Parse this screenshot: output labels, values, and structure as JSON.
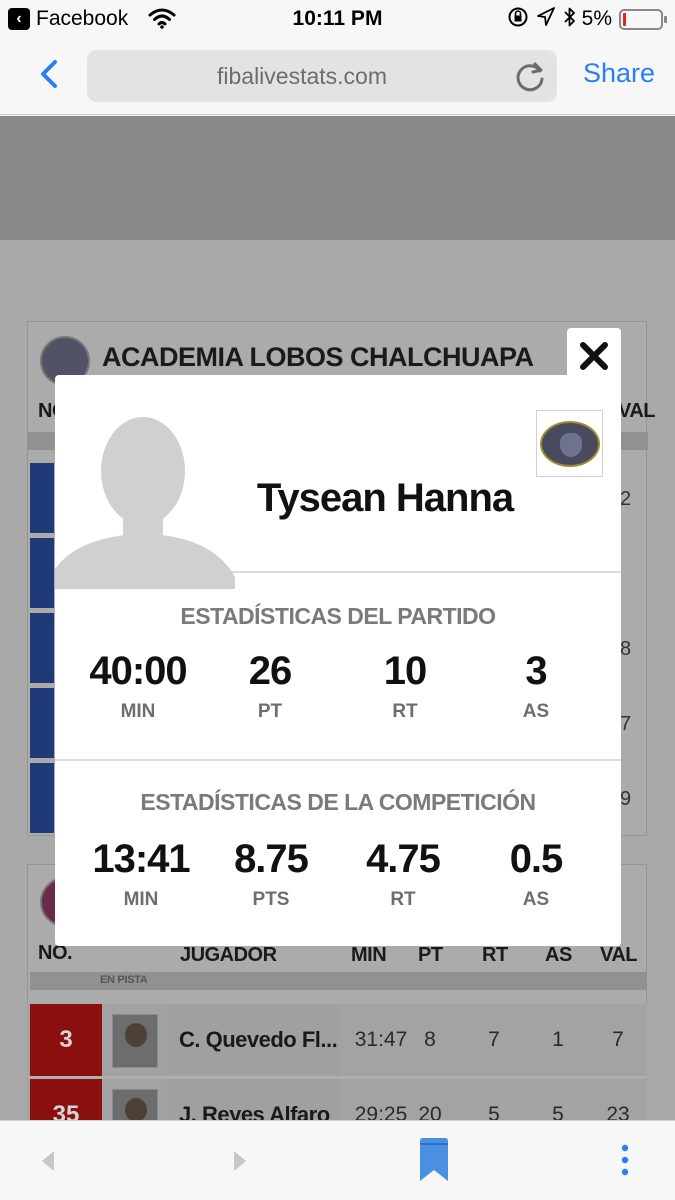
{
  "status_bar": {
    "app_name": "Facebook",
    "time": "10:11 PM",
    "battery_percent": "5%",
    "battery_level": 0.05
  },
  "browser": {
    "url": "fibalivestats.com",
    "share_label": "Share"
  },
  "background_page": {
    "team1": {
      "name": "ACADEMIA LOBOS CHALCHUAPA",
      "col_no": "NO",
      "col_val": "VAL",
      "side_values": [
        "2",
        "",
        "8",
        "7",
        "9"
      ]
    },
    "team2": {
      "headers": [
        "NO.",
        "JUGADOR",
        "MIN",
        "PT",
        "RT",
        "AS",
        "VAL"
      ],
      "en_pista": "EN PISTA",
      "rows": [
        {
          "no": "3",
          "name": "C. Quevedo Fl...",
          "min": "31:47",
          "pt": "8",
          "rt": "7",
          "as": "1",
          "val": "7"
        },
        {
          "no": "35",
          "name": "J. Reyes Alfaro",
          "min": "29:25",
          "pt": "20",
          "rt": "5",
          "as": "5",
          "val": "23"
        }
      ]
    }
  },
  "modal": {
    "player_name": "Tysean Hanna",
    "game_stats": {
      "title": "ESTADÍSTICAS DEL PARTIDO",
      "items": [
        {
          "value": "40:00",
          "label": "MIN"
        },
        {
          "value": "26",
          "label": "PT"
        },
        {
          "value": "10",
          "label": "RT"
        },
        {
          "value": "3",
          "label": "AS"
        }
      ]
    },
    "competition_stats": {
      "title": "ESTADÍSTICAS DE LA COMPETICIÓN",
      "items": [
        {
          "value": "13:41",
          "label": "MIN"
        },
        {
          "value": "8.75",
          "label": "PTS"
        },
        {
          "value": "4.75",
          "label": "RT"
        },
        {
          "value": "0.5",
          "label": "AS"
        }
      ]
    }
  },
  "icons": {
    "close": "close-icon",
    "back": "chevron-left-icon",
    "reload": "reload-icon",
    "bookmarks": "bookmark-icon",
    "more": "more-vertical-icon"
  },
  "colors": {
    "accent_blue": "#2a7ff6",
    "team1_blue": "#203a78",
    "team2_red": "#8a1010",
    "bookmark_blue": "#4a90e2"
  }
}
